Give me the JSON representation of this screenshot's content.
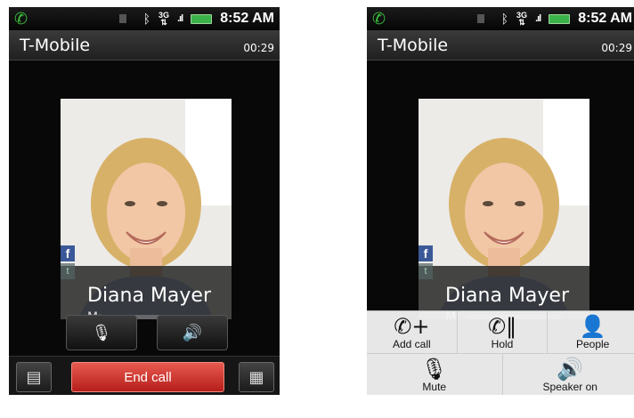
{
  "status": {
    "time": "8:52 AM",
    "network": "3G",
    "icons": [
      "call-icon",
      "bluetooth-icon",
      "3g-icon",
      "signal-icon",
      "battery-icon"
    ]
  },
  "call": {
    "carrier": "T-Mobile",
    "duration": "00:29",
    "contact_name": "Diana Mayer",
    "number_label": "M:"
  },
  "controls": {
    "end_call_label": "End call"
  },
  "menu": {
    "add_call": "Add call",
    "hold": "Hold",
    "people": "People",
    "mute": "Mute",
    "speaker_on": "Speaker on"
  },
  "colors": {
    "end_call": "#c8302a",
    "battery": "#3bb34a",
    "call_icon": "#3cc43c",
    "facebook": "#3b5998"
  }
}
